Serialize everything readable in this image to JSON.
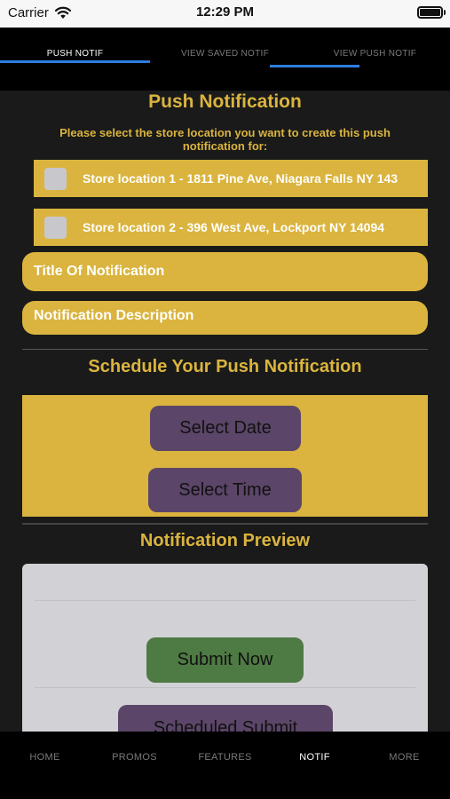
{
  "status_bar": {
    "carrier": "Carrier",
    "time": "12:29 PM"
  },
  "top_tabs": [
    {
      "label": "PUSH NOTIF",
      "active": true
    },
    {
      "label": "VIEW SAVED NOTIF",
      "active": false
    },
    {
      "label": "VIEW PUSH NOTIF",
      "active": false
    }
  ],
  "page": {
    "title": "Push Notification",
    "instructions": "Please select the store location you want to create this push notification for:",
    "stores": [
      {
        "label": "Store location 1 - 1811 Pine Ave, Niagara Falls NY 143",
        "checked": false
      },
      {
        "label": "Store location 2 - 396 West Ave, Lockport NY 14094",
        "checked": false
      }
    ],
    "title_field_placeholder": "Title Of Notification",
    "description_field_placeholder": "Notification Description",
    "schedule_heading": "Schedule Your Push Notification",
    "select_date_label": "Select Date",
    "select_time_label": "Select Time",
    "preview_heading": "Notification Preview",
    "submit_now_label": "Submit Now",
    "scheduled_submit_label": "Scheduled Submit"
  },
  "bottom_nav": [
    {
      "label": "HOME",
      "active": false
    },
    {
      "label": "PROMOS",
      "active": false
    },
    {
      "label": "FEATURES",
      "active": false
    },
    {
      "label": "NOTIF",
      "active": true
    },
    {
      "label": "MORE",
      "active": false
    }
  ],
  "colors": {
    "accent_gold": "#dab43e",
    "button_purple": "#5b4568",
    "button_green": "#4e7a43",
    "tab_indicator_blue": "#2e7ee0",
    "background": "#1a1a1a"
  }
}
